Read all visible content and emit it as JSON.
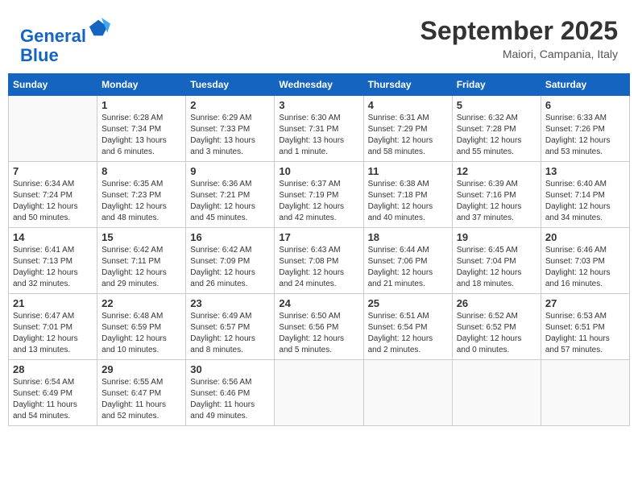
{
  "header": {
    "logo_line1": "General",
    "logo_line2": "Blue",
    "month_title": "September 2025",
    "subtitle": "Maiori, Campania, Italy"
  },
  "days_of_week": [
    "Sunday",
    "Monday",
    "Tuesday",
    "Wednesday",
    "Thursday",
    "Friday",
    "Saturday"
  ],
  "weeks": [
    [
      {
        "day": "",
        "info": ""
      },
      {
        "day": "1",
        "info": "Sunrise: 6:28 AM\nSunset: 7:34 PM\nDaylight: 13 hours\nand 6 minutes."
      },
      {
        "day": "2",
        "info": "Sunrise: 6:29 AM\nSunset: 7:33 PM\nDaylight: 13 hours\nand 3 minutes."
      },
      {
        "day": "3",
        "info": "Sunrise: 6:30 AM\nSunset: 7:31 PM\nDaylight: 13 hours\nand 1 minute."
      },
      {
        "day": "4",
        "info": "Sunrise: 6:31 AM\nSunset: 7:29 PM\nDaylight: 12 hours\nand 58 minutes."
      },
      {
        "day": "5",
        "info": "Sunrise: 6:32 AM\nSunset: 7:28 PM\nDaylight: 12 hours\nand 55 minutes."
      },
      {
        "day": "6",
        "info": "Sunrise: 6:33 AM\nSunset: 7:26 PM\nDaylight: 12 hours\nand 53 minutes."
      }
    ],
    [
      {
        "day": "7",
        "info": "Sunrise: 6:34 AM\nSunset: 7:24 PM\nDaylight: 12 hours\nand 50 minutes."
      },
      {
        "day": "8",
        "info": "Sunrise: 6:35 AM\nSunset: 7:23 PM\nDaylight: 12 hours\nand 48 minutes."
      },
      {
        "day": "9",
        "info": "Sunrise: 6:36 AM\nSunset: 7:21 PM\nDaylight: 12 hours\nand 45 minutes."
      },
      {
        "day": "10",
        "info": "Sunrise: 6:37 AM\nSunset: 7:19 PM\nDaylight: 12 hours\nand 42 minutes."
      },
      {
        "day": "11",
        "info": "Sunrise: 6:38 AM\nSunset: 7:18 PM\nDaylight: 12 hours\nand 40 minutes."
      },
      {
        "day": "12",
        "info": "Sunrise: 6:39 AM\nSunset: 7:16 PM\nDaylight: 12 hours\nand 37 minutes."
      },
      {
        "day": "13",
        "info": "Sunrise: 6:40 AM\nSunset: 7:14 PM\nDaylight: 12 hours\nand 34 minutes."
      }
    ],
    [
      {
        "day": "14",
        "info": "Sunrise: 6:41 AM\nSunset: 7:13 PM\nDaylight: 12 hours\nand 32 minutes."
      },
      {
        "day": "15",
        "info": "Sunrise: 6:42 AM\nSunset: 7:11 PM\nDaylight: 12 hours\nand 29 minutes."
      },
      {
        "day": "16",
        "info": "Sunrise: 6:42 AM\nSunset: 7:09 PM\nDaylight: 12 hours\nand 26 minutes."
      },
      {
        "day": "17",
        "info": "Sunrise: 6:43 AM\nSunset: 7:08 PM\nDaylight: 12 hours\nand 24 minutes."
      },
      {
        "day": "18",
        "info": "Sunrise: 6:44 AM\nSunset: 7:06 PM\nDaylight: 12 hours\nand 21 minutes."
      },
      {
        "day": "19",
        "info": "Sunrise: 6:45 AM\nSunset: 7:04 PM\nDaylight: 12 hours\nand 18 minutes."
      },
      {
        "day": "20",
        "info": "Sunrise: 6:46 AM\nSunset: 7:03 PM\nDaylight: 12 hours\nand 16 minutes."
      }
    ],
    [
      {
        "day": "21",
        "info": "Sunrise: 6:47 AM\nSunset: 7:01 PM\nDaylight: 12 hours\nand 13 minutes."
      },
      {
        "day": "22",
        "info": "Sunrise: 6:48 AM\nSunset: 6:59 PM\nDaylight: 12 hours\nand 10 minutes."
      },
      {
        "day": "23",
        "info": "Sunrise: 6:49 AM\nSunset: 6:57 PM\nDaylight: 12 hours\nand 8 minutes."
      },
      {
        "day": "24",
        "info": "Sunrise: 6:50 AM\nSunset: 6:56 PM\nDaylight: 12 hours\nand 5 minutes."
      },
      {
        "day": "25",
        "info": "Sunrise: 6:51 AM\nSunset: 6:54 PM\nDaylight: 12 hours\nand 2 minutes."
      },
      {
        "day": "26",
        "info": "Sunrise: 6:52 AM\nSunset: 6:52 PM\nDaylight: 12 hours\nand 0 minutes."
      },
      {
        "day": "27",
        "info": "Sunrise: 6:53 AM\nSunset: 6:51 PM\nDaylight: 11 hours\nand 57 minutes."
      }
    ],
    [
      {
        "day": "28",
        "info": "Sunrise: 6:54 AM\nSunset: 6:49 PM\nDaylight: 11 hours\nand 54 minutes."
      },
      {
        "day": "29",
        "info": "Sunrise: 6:55 AM\nSunset: 6:47 PM\nDaylight: 11 hours\nand 52 minutes."
      },
      {
        "day": "30",
        "info": "Sunrise: 6:56 AM\nSunset: 6:46 PM\nDaylight: 11 hours\nand 49 minutes."
      },
      {
        "day": "",
        "info": ""
      },
      {
        "day": "",
        "info": ""
      },
      {
        "day": "",
        "info": ""
      },
      {
        "day": "",
        "info": ""
      }
    ]
  ]
}
